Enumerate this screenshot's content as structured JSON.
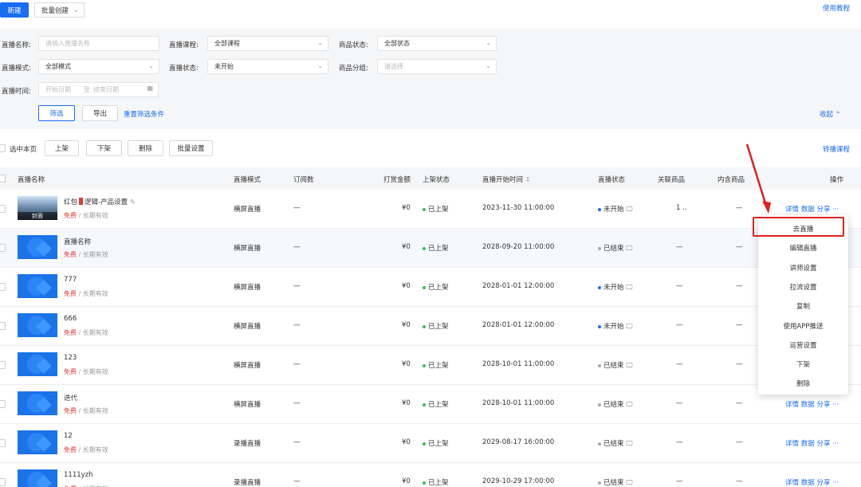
{
  "toolbar": {
    "new_label": "新建",
    "batch_create_label": "批量创建",
    "tutorial_label": "使用教程"
  },
  "filters": {
    "name_label": "直播名称:",
    "name_placeholder": "请输入直播名称",
    "course_label": "直播课程:",
    "course_value": "全部课程",
    "goods_status_label": "商品状态:",
    "goods_status_value": "全部状态",
    "mode_label": "直播模式:",
    "mode_value": "全部模式",
    "live_status_label": "直播状态:",
    "live_status_value": "未开始",
    "goods_group_label": "商品分组:",
    "goods_group_placeholder": "请选择",
    "time_label": "直播时间:",
    "start_placeholder": "开始日期",
    "end_placeholder": "结束日期",
    "range_sep": "至",
    "filter_btn": "筛选",
    "export_btn": "导出",
    "reset_link": "重置筛选条件",
    "collapse_label": "收起"
  },
  "bulk": {
    "select_page": "选中本页",
    "on_shelf": "上架",
    "off_shelf": "下架",
    "delete": "删除",
    "batch_settings": "批量设置",
    "convert_course": "转播课程"
  },
  "columns": {
    "name": "直播名称",
    "mode": "直播模式",
    "orders": "订阅数",
    "reward": "打赏金额",
    "shelf": "上架状态",
    "start_time": "直播开始时间",
    "live_status": "直播状态",
    "related": "关联商品",
    "inner": "内含商品",
    "ops": "操作"
  },
  "rows": [
    {
      "title_a": "红包",
      "title_b": "逻辑-产品设置",
      "price": "免费",
      "validity": " / 长期有效",
      "mode": "横屏直播",
      "orders": "—",
      "reward": "¥0",
      "shelf": "已上架",
      "start": "2023-11-30 11:00:00",
      "status": "未开始",
      "related": "1 ..",
      "inner": "—",
      "thumb_caption": "封面"
    },
    {
      "title": "直播名称",
      "price": "免费",
      "validity": " / 长期有效",
      "mode": "横屏直播",
      "orders": "—",
      "reward": "¥0",
      "shelf": "已上架",
      "start": "2028-09-20 11:00:00",
      "status": "已结束",
      "related": "—",
      "inner": "—"
    },
    {
      "title": "777",
      "price": "免费",
      "validity": " / 长期有效",
      "mode": "横屏直播",
      "orders": "—",
      "reward": "¥0",
      "shelf": "已上架",
      "start": "2028-01-01 12:00:00",
      "status": "未开始",
      "related": "—",
      "inner": "—"
    },
    {
      "title": "666",
      "price": "免费",
      "validity": " / 长期有效",
      "mode": "横屏直播",
      "orders": "—",
      "reward": "¥0",
      "shelf": "已上架",
      "start": "2028-01-01 12:00:00",
      "status": "未开始",
      "related": "—",
      "inner": "—"
    },
    {
      "title": "123",
      "price": "免费",
      "validity": " / 长期有效",
      "mode": "横屏直播",
      "orders": "—",
      "reward": "¥0",
      "shelf": "已上架",
      "start": "2028-10-01 11:00:00",
      "status": "已结束",
      "related": "—",
      "inner": "—"
    },
    {
      "title": "迭代",
      "price": "免费",
      "validity": " / 长期有效",
      "mode": "横屏直播",
      "orders": "—",
      "reward": "¥0",
      "shelf": "已上架",
      "start": "2028-10-01 11:00:00",
      "status": "已结束",
      "related": "—",
      "inner": "—"
    },
    {
      "title": "12",
      "price": "免费",
      "validity": " / 长期有效",
      "mode": "录播直播",
      "orders": "—",
      "reward": "¥0",
      "shelf": "已上架",
      "start": "2029-08-17 16:00:00",
      "status": "已结束",
      "related": "—",
      "inner": "—"
    },
    {
      "title": "1111yzh",
      "price": "免费",
      "validity": " / 长期有效",
      "mode": "录播直播",
      "orders": "—",
      "reward": "¥0",
      "shelf": "已上架",
      "start": "2029-10-29 17:00:00",
      "status": "已结束",
      "related": "—",
      "inner": "—"
    }
  ],
  "ops_labels": {
    "detail": "详情",
    "data": "数据",
    "share": "分享",
    "more": "···"
  },
  "menu": [
    "去直播",
    "编辑直播",
    "讲师设置",
    "拉流设置",
    "复制",
    "使用APP推送",
    "运营设置",
    "下架",
    "删除"
  ],
  "colors": {
    "accent": "#1a6cf0",
    "free": "#e53935",
    "annotation": "#e02020"
  }
}
